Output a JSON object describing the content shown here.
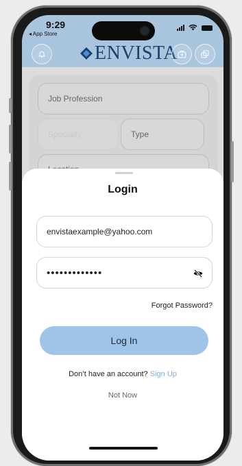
{
  "status_bar": {
    "time": "9:29",
    "back_label": "◂ App Store"
  },
  "header": {
    "brand_name": "ENVISTA",
    "left_icon": "bell-icon",
    "right_icons": [
      "briefcase-plus-icon",
      "share-icon"
    ]
  },
  "background_form": {
    "job_profession_placeholder": "Job Profession",
    "specialty_placeholder": "Specialty",
    "type_placeholder": "Type",
    "location_placeholder": "Location"
  },
  "login_sheet": {
    "title": "Login",
    "email_value": "envistaexample@yahoo.com",
    "password_value": "•••••••••••••",
    "password_visibility_icon": "eye-off-icon",
    "forgot_password": "Forgot Password?",
    "login_button": "Log In",
    "no_account_text": "Don’t have an account?",
    "signup_link": "Sign Up",
    "not_now": "Not Now"
  },
  "colors": {
    "header_bg": "#a9c4dd",
    "brand": "#1b3e6e",
    "button_bg": "#9fc4e8",
    "link": "#7fb0e0"
  }
}
